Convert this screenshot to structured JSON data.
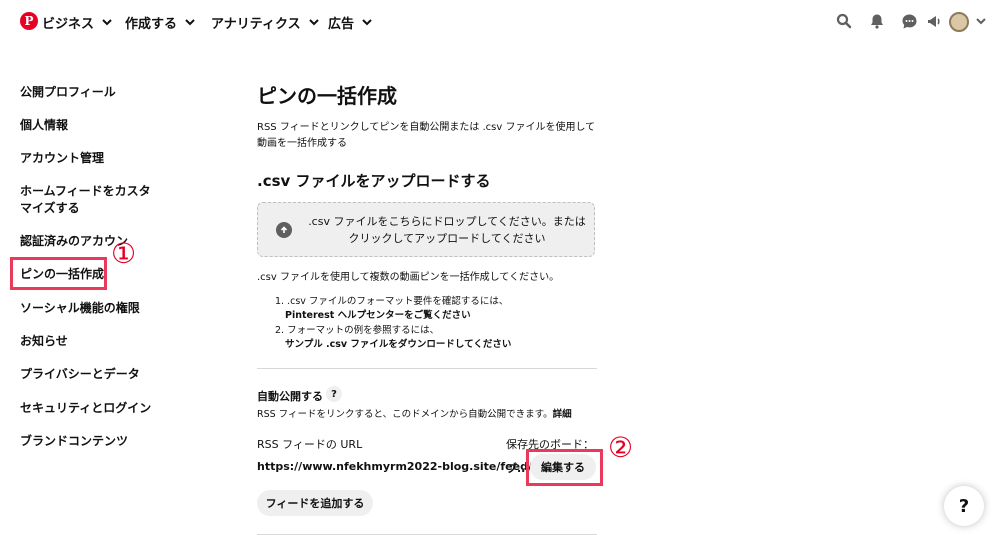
{
  "topnav": {
    "logo_icon": "pinterest-logo",
    "logo_letter": "P",
    "brand_color": "#e60023",
    "items": [
      {
        "label": "ビジネス"
      },
      {
        "label": "作成する"
      },
      {
        "label": "アナリティクス"
      },
      {
        "label": "広告"
      }
    ],
    "right_icons": [
      "search-icon",
      "bell-icon",
      "message-icon",
      "megaphone-icon",
      "avatar",
      "chevron-down-icon"
    ]
  },
  "sidebar": {
    "items": [
      {
        "label": "公開プロフィール"
      },
      {
        "label": "個人情報"
      },
      {
        "label": "アカウント管理"
      },
      {
        "label": "ホームフィードをカスタ"
      },
      {
        "label": "マイズする"
      },
      {
        "label": "認証済みのアカウン"
      },
      {
        "label": "ピンの一括作成"
      },
      {
        "label": "ソーシャル機能の権限"
      },
      {
        "label": "お知らせ"
      },
      {
        "label": "プライバシーとデータ"
      },
      {
        "label": "セキュリティとログイン"
      },
      {
        "label": "ブランドコンテンツ"
      }
    ]
  },
  "main": {
    "title": "ピンの一括作成",
    "description": "RSS フィードとリンクしてピンを自動公開または .csv ファイルを使用して動画を一括作成する",
    "csv_section_title": ".csv ファイルをアップロードする",
    "dropzone_line1": ".csv ファイルをこちらにドロップしてください。または",
    "dropzone_line2": "クリックしてアップロードしてください",
    "csv_info": ".csv ファイルを使用して複数の動画ピンを一括作成してください。",
    "step1_text": "1. .csv ファイルのフォーマット要件を確認するには、",
    "step1_link": "Pinterest ヘルプセンターをご覧ください",
    "step2_text": "2. フォーマットの例を参照するには、",
    "step2_link": "サンプル .csv ファイルをダウンロードしてください",
    "auto_publish_label": "自動公開する",
    "help_mark": "?",
    "auto_publish_desc": "RSS フィードをリンクすると、このドメインから自動公開できます。",
    "details_link": "詳細",
    "rss_url_label": "RSS フィードの URL",
    "board_label": "保存先のボード：",
    "feed_url": "https://www.nfekhmyrm2022-blog.site/feed/",
    "board_value": "ブ...",
    "edit_button": "編集する",
    "add_feed_button": "フィードを追加する"
  },
  "annotations": {
    "marker1": "①",
    "marker2": "②",
    "color": "#e83a5a"
  },
  "help_fab": "?"
}
